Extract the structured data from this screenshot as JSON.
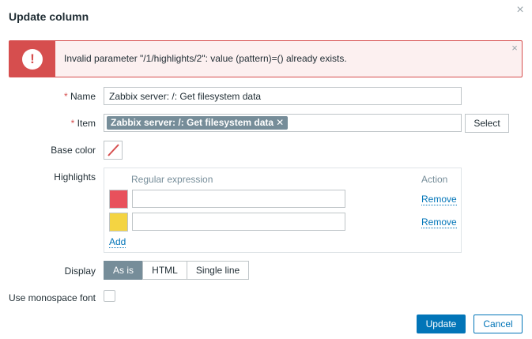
{
  "dialog": {
    "title": "Update column"
  },
  "error": {
    "message": "Invalid parameter \"/1/highlights/2\": value (pattern)=() already exists."
  },
  "form": {
    "name": {
      "required_mark": "*",
      "label": "Name",
      "value": "Zabbix server: /: Get filesystem data"
    },
    "item": {
      "required_mark": "*",
      "label": "Item",
      "chip": "Zabbix server: /: Get filesystem data",
      "chip_remove": "✕",
      "select_label": "Select"
    },
    "base_color": {
      "label": "Base color"
    },
    "highlights": {
      "label": "Highlights",
      "header_regex": "Regular expression",
      "header_action": "Action",
      "rows": [
        {
          "color": "#e8515c",
          "value": "",
          "remove_label": "Remove"
        },
        {
          "color": "#f4d442",
          "value": "",
          "remove_label": "Remove"
        }
      ],
      "add_label": "Add"
    },
    "display": {
      "label": "Display",
      "options": [
        "As is",
        "HTML",
        "Single line"
      ],
      "selected": "As is"
    },
    "monospace": {
      "label": "Use monospace font",
      "checked": false
    }
  },
  "footer": {
    "update_label": "Update",
    "cancel_label": "Cancel"
  },
  "icons": {
    "close": "×",
    "error": "!"
  },
  "colors": {
    "accent": "#0275b8",
    "error": "#d64e4e",
    "segment_active": "#768d99"
  }
}
